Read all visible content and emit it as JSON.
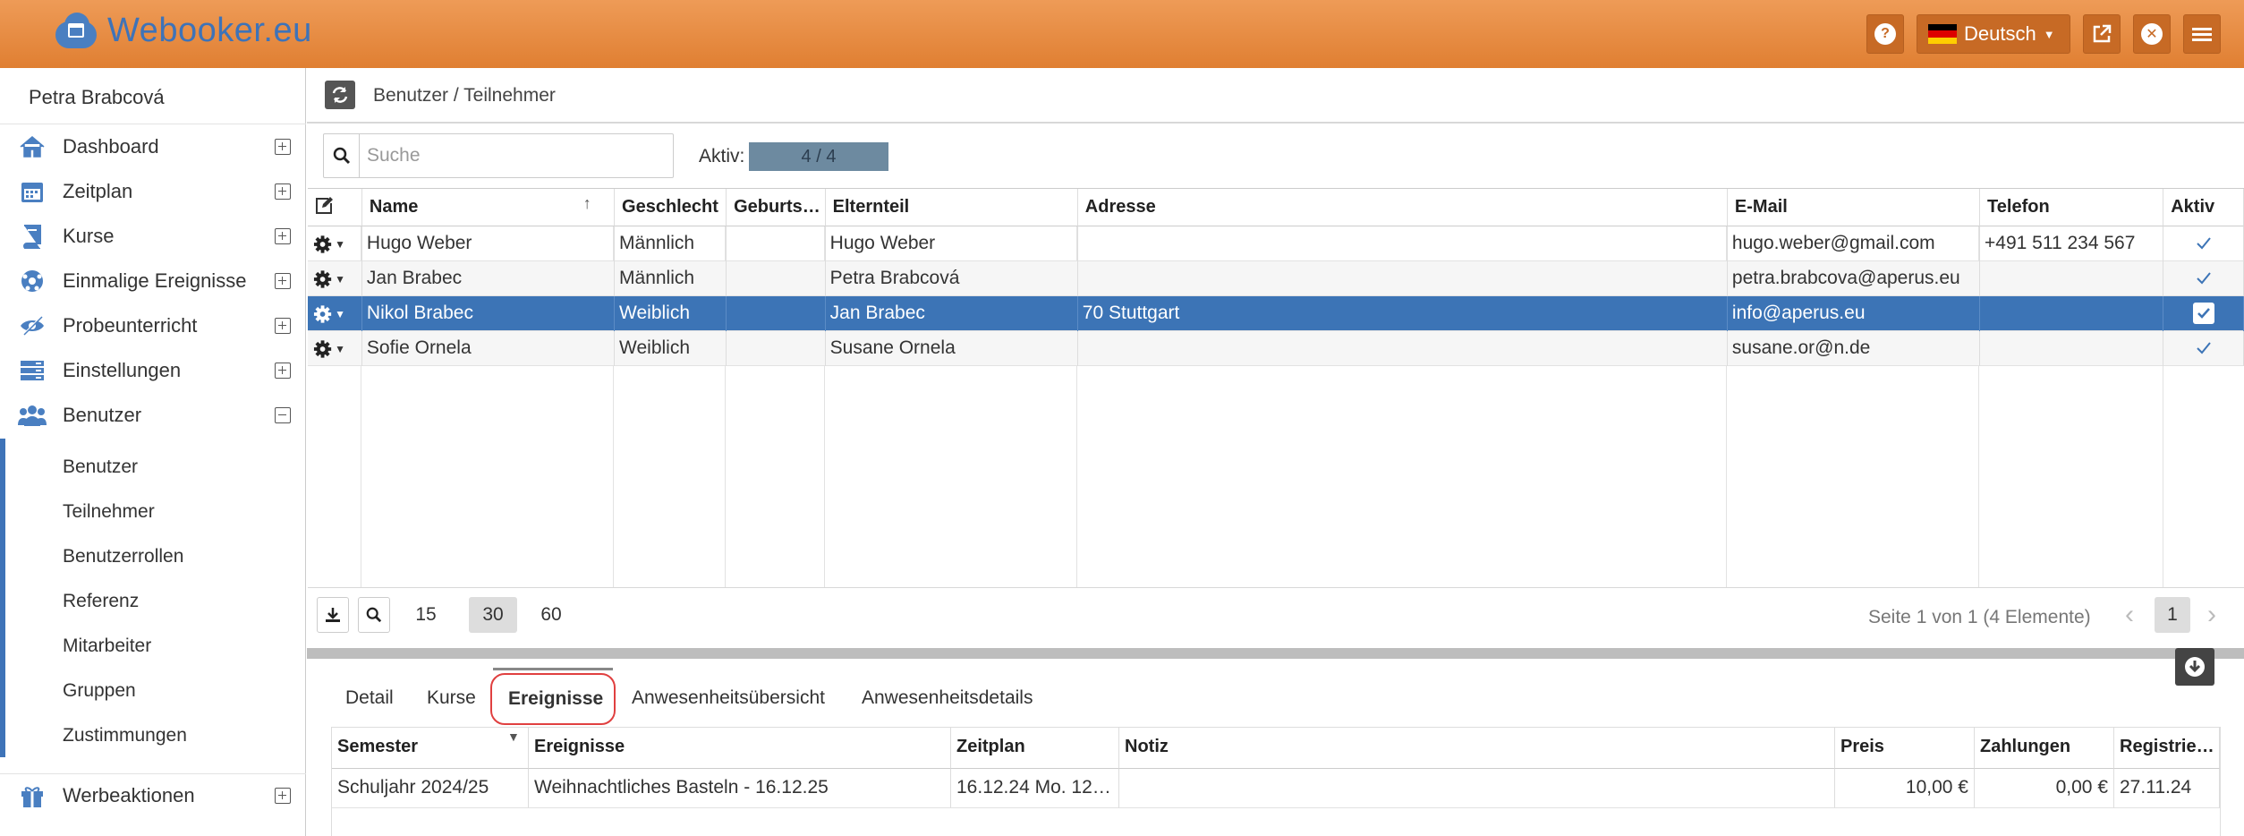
{
  "app": {
    "logo_text": "Webooker.eu",
    "brand_color": "#e88c44",
    "accent": "#3c74b6"
  },
  "header": {
    "language": "Deutsch",
    "help_icon": "question-circle-icon",
    "external_icon": "external-link-icon",
    "close_icon": "close-circle-icon",
    "menu_icon": "hamburger-icon"
  },
  "sidebar": {
    "user": "Petra Brabcová",
    "items": [
      {
        "label": "Dashboard",
        "icon": "home-icon"
      },
      {
        "label": "Zeitplan",
        "icon": "calendar-icon"
      },
      {
        "label": "Kurse",
        "icon": "book-icon"
      },
      {
        "label": "Einmalige Ereignisse",
        "icon": "ball-icon"
      },
      {
        "label": "Probeunterricht",
        "icon": "eye-icon"
      },
      {
        "label": "Einstellungen",
        "icon": "settings-icon"
      },
      {
        "label": "Benutzer",
        "icon": "users-icon"
      },
      {
        "label": "Werbeaktionen",
        "icon": "gift-icon"
      }
    ],
    "subitems": [
      "Benutzer",
      "Teilnehmer",
      "Benutzerrollen",
      "Referenz",
      "Mitarbeiter",
      "Gruppen",
      "Zustimmungen"
    ]
  },
  "breadcrumb": "Benutzer / Teilnehmer",
  "search": {
    "placeholder": "Suche"
  },
  "filter": {
    "label": "Aktiv:",
    "value": "4 / 4"
  },
  "grid": {
    "columns": [
      "Name",
      "Geschlecht",
      "Geburts…",
      "Elternteil",
      "Adresse",
      "E-Mail",
      "Telefon",
      "Aktiv"
    ],
    "rows": [
      {
        "name": "Hugo Weber",
        "gender": "Männlich",
        "birth": "",
        "parent": "Hugo Weber",
        "address": "",
        "email": "hugo.weber@gmail.com",
        "phone": "+491 511 234 567",
        "active": true
      },
      {
        "name": "Jan Brabec",
        "gender": "Männlich",
        "birth": "",
        "parent": "Petra Brabcová",
        "address": "",
        "email": "petra.brabcova@aperus.eu",
        "phone": "",
        "active": true
      },
      {
        "name": "Nikol Brabec",
        "gender": "Weiblich",
        "birth": "",
        "parent": "Jan Brabec",
        "address": "70 Stuttgart",
        "email": "info@aperus.eu",
        "phone": "",
        "active": true
      },
      {
        "name": "Sofie Ornela",
        "gender": "Weiblich",
        "birth": "",
        "parent": "Susane Ornela",
        "address": "",
        "email": "susane.or@n.de",
        "phone": "",
        "active": true
      }
    ]
  },
  "pager": {
    "sizes": [
      "15",
      "30",
      "60"
    ],
    "active_size": "30",
    "info": "Seite 1 von 1 (4 Elemente)",
    "page": "1"
  },
  "detail": {
    "tabs": [
      "Detail",
      "Kurse",
      "Ereignisse",
      "Anwesenheitsübersicht",
      "Anwesenheitsdetails"
    ],
    "active_tab": "Ereignisse",
    "columns": [
      "Semester",
      "Ereignisse",
      "Zeitplan",
      "Notiz",
      "Preis",
      "Zahlungen",
      "Registrie…"
    ],
    "rows": [
      {
        "semester": "Schuljahr 2024/25",
        "event": "Weihnachtliches Basteln - 16.12.25",
        "schedule": "16.12.24 Mo. 12…",
        "note": "",
        "price": "10,00 €",
        "payments": "0,00 €",
        "registered": "27.11.24"
      }
    ]
  }
}
